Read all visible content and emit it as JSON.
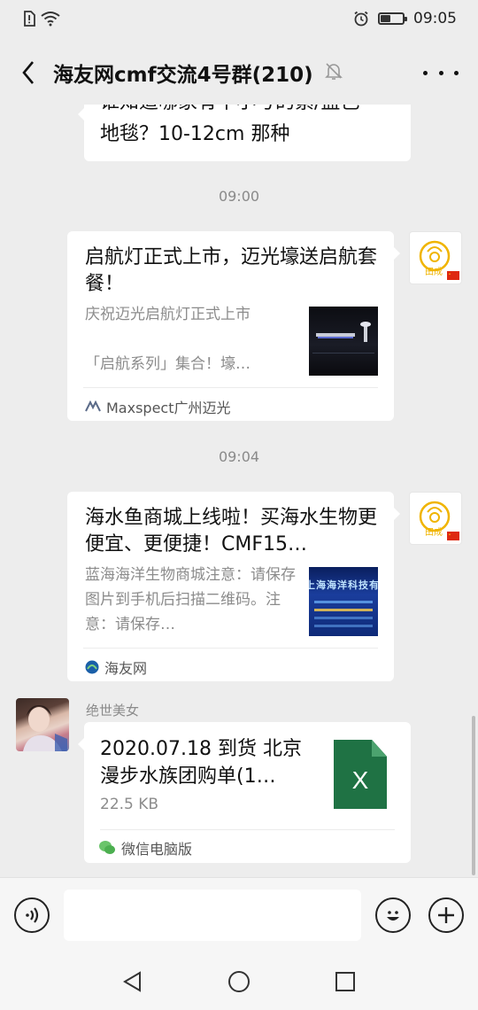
{
  "status_bar": {
    "time": "09:05",
    "icons": [
      "sim-alert-icon",
      "wifi-icon",
      "alarm-icon",
      "battery-icon"
    ],
    "battery_level": 0.45
  },
  "header": {
    "title": "海友网cmf交流4号群(210)",
    "back_icon": "back-arrow-icon",
    "mute_icon": "mute-bell-icon",
    "more_icon": "more-icon"
  },
  "messages": {
    "partial_question": {
      "line1": "谁知道哪家有中小号的紫/蓝色",
      "line2": "地毯？10-12cm 那种"
    },
    "time_1": "09:00",
    "card_1": {
      "title": "启航灯正式上市，迈光壕送启航套餐！",
      "desc_line1": "庆祝迈光启航灯正式上市",
      "desc_line2": "「启航系列」集合！壕…",
      "source": "Maxspect广州迈光",
      "sender_avatar_text": "田成"
    },
    "time_2": "09:04",
    "card_2": {
      "title": "海水鱼商城上线啦！买海水生物更便宜、更便捷！CMF15…",
      "desc": "蓝海海洋生物商城注意：请保存图片到手机后扫描二维码。注意：请保存…",
      "source": "海友网",
      "thumb_text": "上海海洋科技有",
      "sender_avatar_text": "田成"
    },
    "file_message": {
      "sender_name": "绝世美女",
      "file_name": "2020.07.18 到货 北京漫步水族团购单(1…",
      "file_size": "22.5 KB",
      "file_icon_letter": "X",
      "source": "微信电脑版"
    }
  },
  "input_bar": {
    "voice_icon": "voice-icon",
    "emoji_icon": "emoji-icon",
    "plus_icon": "plus-icon",
    "placeholder": ""
  },
  "nav_bar": {
    "icons": [
      "nav-back-icon",
      "nav-home-icon",
      "nav-recents-icon"
    ]
  },
  "colors": {
    "background": "#ededed",
    "bubble": "#ffffff",
    "excel_green": "#1f7244",
    "china_flag_red": "#de2910"
  }
}
